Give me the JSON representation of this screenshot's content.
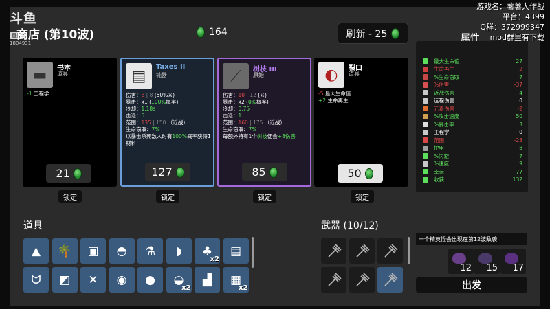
{
  "overlay": {
    "lines": [
      "游戏名：薯薯大作战",
      "平台：4399",
      "Q群：372999347",
      "mod群里有下载"
    ],
    "logo": "斗鱼",
    "logo_badge": "直播",
    "room": "1804931"
  },
  "shop": {
    "title": "商店 (第10波)",
    "materials": "164",
    "reroll_label": "刷新 - 25"
  },
  "cards": [
    {
      "name": "书本",
      "type": "道具",
      "icon": "book-icon",
      "stats": [
        {
          "parts": [
            {
              "t": "-1",
              "c": "g"
            },
            {
              "t": " 工程学",
              "c": ""
            }
          ]
        }
      ],
      "price": "21",
      "lock": "锁定"
    },
    {
      "name": "Taxes II",
      "type": "钝器",
      "icon": "paper-icon",
      "stats": [
        {
          "parts": [
            {
              "t": "伤害：",
              "c": ""
            },
            {
              "t": "8",
              "c": "r"
            },
            {
              "t": " | 8 ",
              "c": "dim"
            },
            {
              "t": "(50%",
              "c": ""
            },
            {
              "t": "⚔)",
              "c": ""
            }
          ]
        },
        {
          "parts": [
            {
              "t": "暴击：x1 (",
              "c": ""
            },
            {
              "t": "100%",
              "c": "g"
            },
            {
              "t": "概率)",
              "c": ""
            }
          ]
        },
        {
          "parts": [
            {
              "t": "冷却：",
              "c": ""
            },
            {
              "t": "1.18s",
              "c": "g"
            }
          ]
        },
        {
          "parts": [
            {
              "t": "击退：",
              "c": ""
            },
            {
              "t": "5",
              "c": "g"
            }
          ]
        },
        {
          "parts": [
            {
              "t": "范围：",
              "c": ""
            },
            {
              "t": "135",
              "c": "r"
            },
            {
              "t": " | 150 ",
              "c": "dim"
            },
            {
              "t": "（近战）",
              "c": ""
            }
          ]
        },
        {
          "parts": [
            {
              "t": "生命窃取：",
              "c": ""
            },
            {
              "t": "7%",
              "c": "g"
            }
          ]
        },
        {
          "parts": [
            {
              "t": "以暴击杀死敌人时有",
              "c": ""
            },
            {
              "t": "100%",
              "c": "g"
            },
            {
              "t": "概率获得1个",
              "c": ""
            }
          ]
        },
        {
          "parts": [
            {
              "t": "材料",
              "c": ""
            }
          ]
        }
      ],
      "price": "127",
      "lock": "锁定"
    },
    {
      "name": "树枝 III",
      "type": "原始",
      "icon": "branch-icon",
      "stats": [
        {
          "parts": [
            {
              "t": "伤害：",
              "c": ""
            },
            {
              "t": "10",
              "c": "r"
            },
            {
              "t": " | 12 ",
              "c": "dim"
            },
            {
              "t": "(",
              "c": ""
            },
            {
              "t": "⚔)",
              "c": ""
            }
          ]
        },
        {
          "parts": [
            {
              "t": "暴击：x2 (",
              "c": ""
            },
            {
              "t": "0%",
              "c": "g"
            },
            {
              "t": "概率)",
              "c": ""
            }
          ]
        },
        {
          "parts": [
            {
              "t": "冷却：",
              "c": ""
            },
            {
              "t": "0.75",
              "c": "g"
            }
          ]
        },
        {
          "parts": [
            {
              "t": "击退：",
              "c": ""
            },
            {
              "t": "1",
              "c": "g"
            }
          ]
        },
        {
          "parts": [
            {
              "t": "范围：",
              "c": ""
            },
            {
              "t": "160",
              "c": "r"
            },
            {
              "t": " | 175 ",
              "c": "dim"
            },
            {
              "t": "（近战）",
              "c": ""
            }
          ]
        },
        {
          "parts": [
            {
              "t": "生命窃取：",
              "c": ""
            },
            {
              "t": "7%",
              "c": "g"
            }
          ]
        },
        {
          "parts": [
            {
              "t": "每额外持有1个",
              "c": ""
            },
            {
              "t": "树枝",
              "c": "g"
            },
            {
              "t": "便会",
              "c": ""
            },
            {
              "t": "+8伤害",
              "c": "g"
            }
          ]
        }
      ],
      "price": "85",
      "lock": "锁定"
    },
    {
      "name": "裂口",
      "type": "道具",
      "icon": "wound-icon",
      "stats": [
        {
          "parts": [
            {
              "t": "-5",
              "c": "r"
            },
            {
              "t": " 最大生命值",
              "c": ""
            }
          ]
        },
        {
          "parts": [
            {
              "t": "+2",
              "c": "g"
            },
            {
              "t": " 生命再生",
              "c": ""
            }
          ]
        }
      ],
      "price": "50",
      "lock": "锁定"
    }
  ],
  "attributes": {
    "title": "属性",
    "rows": [
      {
        "label": "最大生命值",
        "value": "27",
        "color": "#5ce05c",
        "icon_color": "#5ce05c"
      },
      {
        "label": "生命再生",
        "value": "-2",
        "color": "#e04848",
        "icon_color": "#d04040"
      },
      {
        "label": "%生命窃取",
        "value": "7",
        "color": "#5ce05c",
        "icon_color": "#c84848"
      },
      {
        "label": "%伤害",
        "value": "-37",
        "color": "#e04848",
        "icon_color": "#d85050"
      },
      {
        "label": "近战伤害",
        "value": "4",
        "color": "#5ce05c",
        "icon_color": "#c8c8c8"
      },
      {
        "label": "远程伤害",
        "value": "0",
        "color": "#ffffff",
        "icon_color": "#c8c8c8"
      },
      {
        "label": "元素伤害",
        "value": "-2",
        "color": "#e04848",
        "icon_color": "#e07030"
      },
      {
        "label": "%攻击速度",
        "value": "50",
        "color": "#5ce05c",
        "icon_color": "#d0a050"
      },
      {
        "label": "%暴击率",
        "value": "3",
        "color": "#5ce05c",
        "icon_color": "#e0e0e0"
      },
      {
        "label": "工程学",
        "value": "0",
        "color": "#ffffff",
        "icon_color": "#c8c8c8"
      },
      {
        "label": "范围",
        "value": "-23",
        "color": "#e04848",
        "icon_color": "#d84848"
      },
      {
        "label": "护甲",
        "value": "8",
        "color": "#5ce05c",
        "icon_color": "#a0a0a0"
      },
      {
        "label": "%闪避",
        "value": "7",
        "color": "#5ce05c",
        "icon_color": "#5ce05c"
      },
      {
        "label": "%速度",
        "value": "9",
        "color": "#5ce05c",
        "icon_color": "#c8c8c8"
      },
      {
        "label": "幸运",
        "value": "77",
        "color": "#5ce05c",
        "icon_color": "#5ce05c"
      },
      {
        "label": "收获",
        "value": "132",
        "color": "#5ce05c",
        "icon_color": "#5ce05c"
      }
    ]
  },
  "items_section": {
    "title": "道具",
    "slots": [
      {
        "icon": "shark-fin-icon",
        "glyph": "▲",
        "count": ""
      },
      {
        "icon": "palm-tree-icon",
        "glyph": "🌴",
        "count": ""
      },
      {
        "icon": "robot-icon",
        "glyph": "▣",
        "count": ""
      },
      {
        "icon": "hat-icon",
        "glyph": "◓",
        "count": ""
      },
      {
        "icon": "potion-icon",
        "glyph": "⚗",
        "count": ""
      },
      {
        "icon": "horn-icon",
        "glyph": "◗",
        "count": ""
      },
      {
        "icon": "tree-icon",
        "glyph": "♣",
        "count": "x2"
      },
      {
        "icon": "scroll-icon",
        "glyph": "▤",
        "count": ""
      },
      {
        "icon": "claw-icon",
        "glyph": "ᗢ",
        "count": ""
      },
      {
        "icon": "bandage-icon",
        "glyph": "◩",
        "count": ""
      },
      {
        "icon": "thorn-icon",
        "glyph": "✕",
        "count": ""
      },
      {
        "icon": "frog-icon",
        "glyph": "◉",
        "count": ""
      },
      {
        "icon": "poop-icon",
        "glyph": "●",
        "count": ""
      },
      {
        "icon": "mushroom-icon",
        "glyph": "◒",
        "count": "x2"
      },
      {
        "icon": "wheelbarrow-icon",
        "glyph": "▟",
        "count": ""
      },
      {
        "icon": "map-icon",
        "glyph": "▦",
        "count": "x2"
      }
    ]
  },
  "weapons_section": {
    "title": "武器 (10/12)",
    "slots": [
      {
        "icon": "pitchfork-icon"
      },
      {
        "icon": "pitchfork-icon"
      },
      {
        "icon": "pitchfork-icon"
      },
      {
        "icon": "pitchfork-icon"
      },
      {
        "icon": "pitchfork-icon"
      },
      {
        "icon": "pitchfork-icon"
      }
    ]
  },
  "elite_message": "一个精英怪会出现在第12波敌袭",
  "enemies": [
    {
      "count": "12"
    },
    {
      "count": "15"
    },
    {
      "count": "17"
    }
  ],
  "go_button": "出发"
}
